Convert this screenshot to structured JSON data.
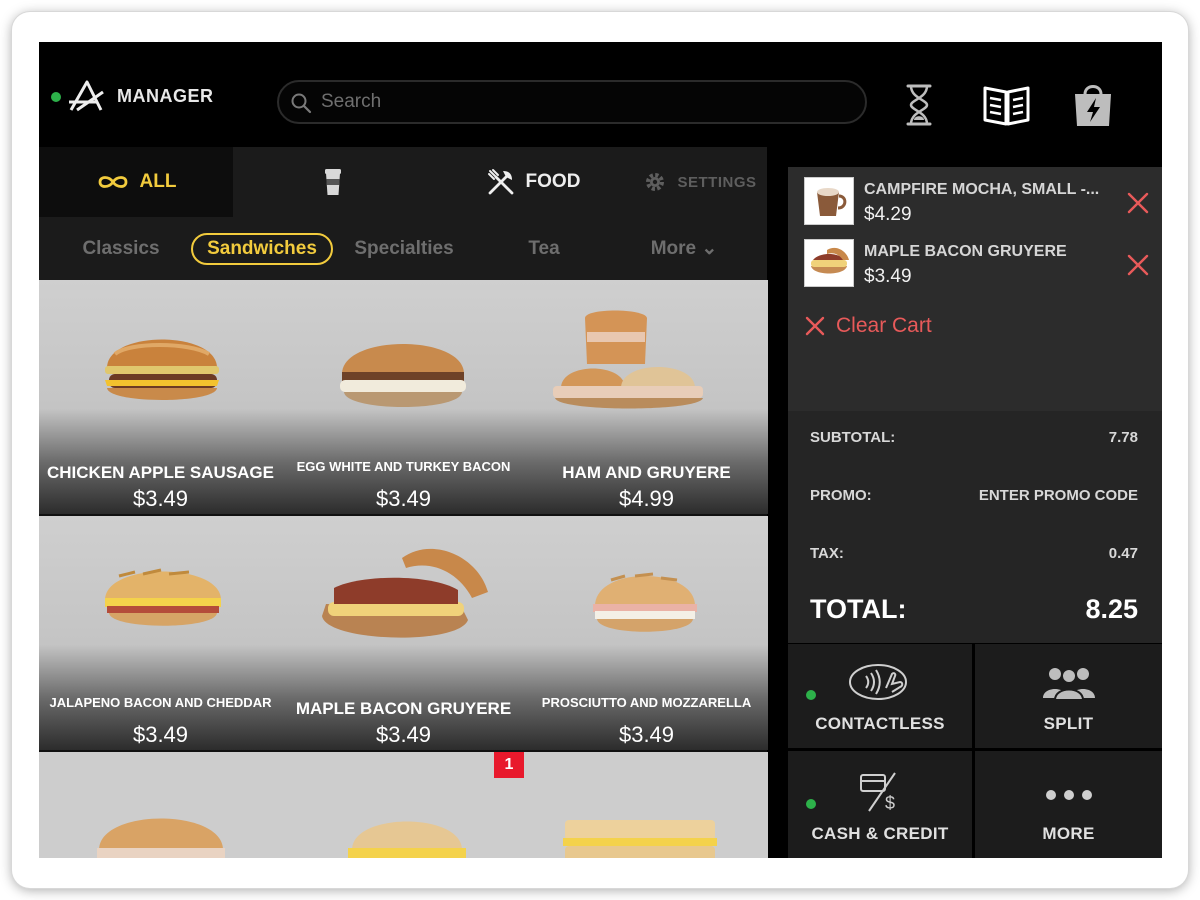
{
  "header": {
    "brand_label": "MANAGER",
    "search_placeholder": "Search"
  },
  "categories": {
    "all": "ALL",
    "food": "FOOD",
    "settings": "SETTINGS"
  },
  "subcategories": [
    "Classics",
    "Sandwiches",
    "Specialties",
    "Tea",
    "More ⌄"
  ],
  "active_subcategory": "Sandwiches",
  "menu_items": [
    {
      "name": "CHICKEN APPLE SAUSAGE",
      "price": "$3.49"
    },
    {
      "name": "EGG WHITE AND TURKEY BACON",
      "price": "$3.49"
    },
    {
      "name": "HAM AND GRUYERE",
      "price": "$4.99"
    },
    {
      "name": "JALAPENO BACON AND CHEDDAR",
      "price": "$3.49"
    },
    {
      "name": "MAPLE BACON GRUYERE",
      "price": "$3.49"
    },
    {
      "name": "PROSCIUTTO AND MOZZARELLA",
      "price": "$3.49"
    }
  ],
  "selected_count_badge": "1",
  "cart": {
    "items": [
      {
        "name": "CAMPFIRE MOCHA, SMALL  -...",
        "price": "$4.29"
      },
      {
        "name": "MAPLE BACON GRUYERE",
        "price": "$3.49"
      }
    ],
    "clear_label": "Clear Cart"
  },
  "summary": {
    "subtotal_label": "SUBTOTAL:",
    "subtotal_value": "7.78",
    "promo_label": "PROMO:",
    "promo_value": "ENTER PROMO CODE",
    "tax_label": "TAX:",
    "tax_value": "0.47",
    "total_label": "TOTAL:",
    "total_value": "8.25"
  },
  "payment": {
    "contactless": "CONTACTLESS",
    "split": "SPLIT",
    "cash_credit": "CASH & CREDIT",
    "more": "MORE"
  },
  "colors": {
    "accent": "#f2cb3d",
    "danger": "#e85a5a",
    "badge": "#e8192c",
    "online": "#2db14a"
  },
  "icons": [
    "logo-icon",
    "search-icon",
    "hourglass-icon",
    "menu-book-icon",
    "bolt-bag-icon",
    "infinity-icon",
    "cup-icon",
    "fork-knife-icon",
    "gear-icon",
    "close-icon",
    "contactless-icon",
    "group-icon",
    "cash-card-icon",
    "more-dots-icon"
  ]
}
